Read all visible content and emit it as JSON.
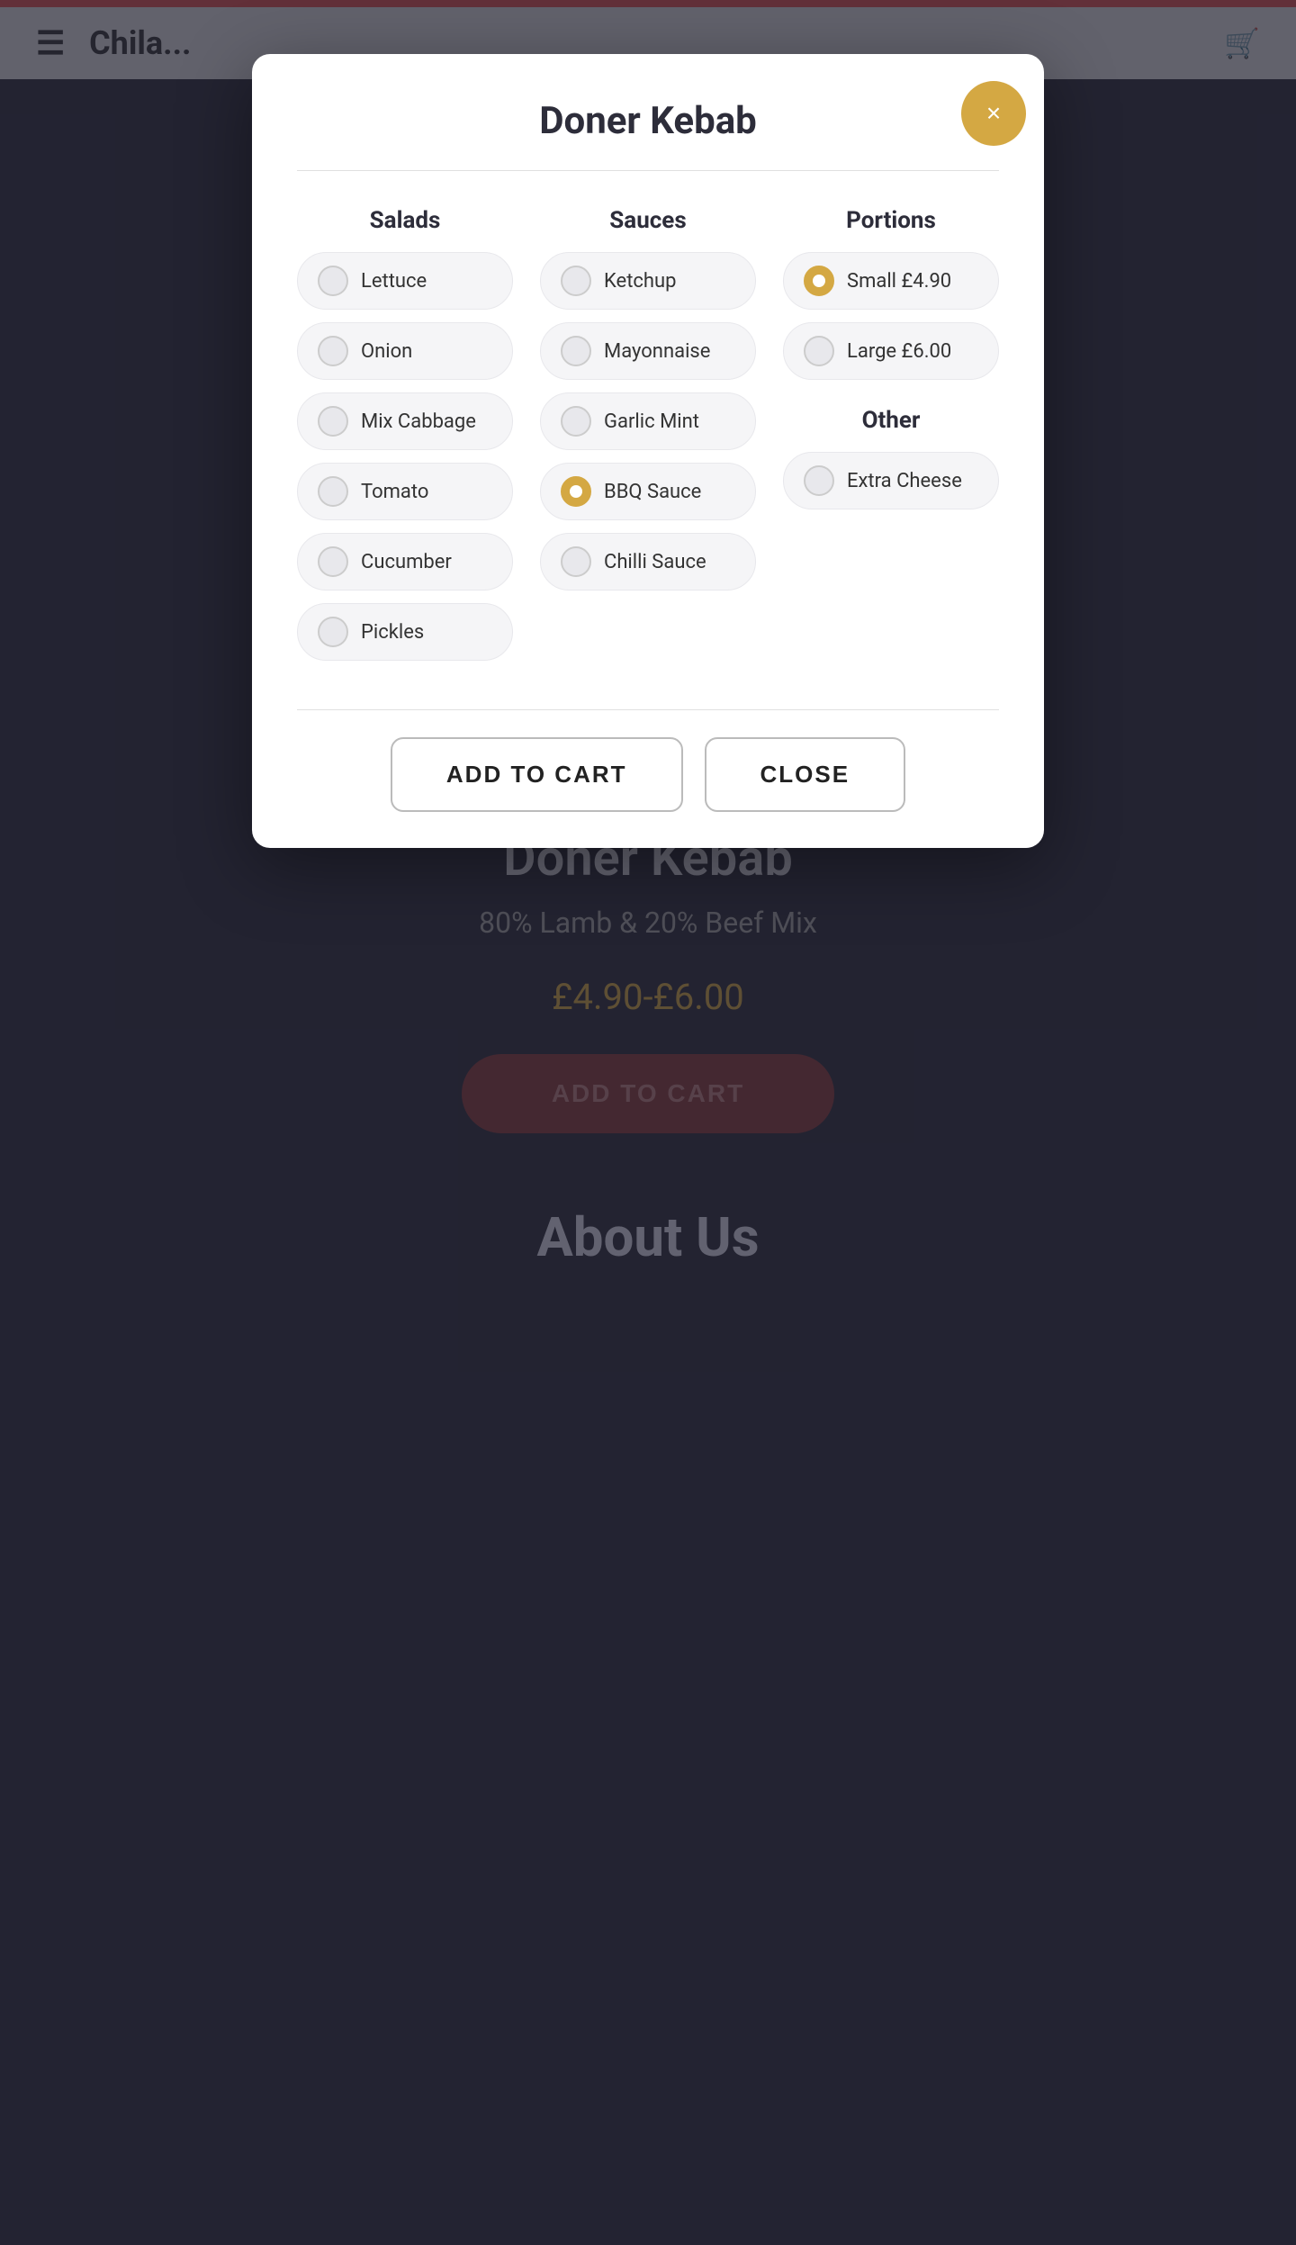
{
  "topbar": {
    "color": "#e05252"
  },
  "header": {
    "logo": "Chila...",
    "cart_icon": "🛒"
  },
  "modal": {
    "title": "Doner Kebab",
    "close_label": "×",
    "divider": true,
    "columns": {
      "salads": {
        "title": "Salads",
        "items": [
          {
            "label": "Lettuce",
            "selected": false
          },
          {
            "label": "Onion",
            "selected": false
          },
          {
            "label": "Mix Cabbage",
            "selected": false
          },
          {
            "label": "Tomato",
            "selected": false
          },
          {
            "label": "Cucumber",
            "selected": false
          },
          {
            "label": "Pickles",
            "selected": false
          }
        ]
      },
      "sauces": {
        "title": "Sauces",
        "items": [
          {
            "label": "Ketchup",
            "selected": false
          },
          {
            "label": "Mayonnaise",
            "selected": false
          },
          {
            "label": "Garlic Mint",
            "selected": false
          },
          {
            "label": "BBQ Sauce",
            "selected": true
          },
          {
            "label": "Chilli Sauce",
            "selected": false
          }
        ]
      },
      "portions": {
        "title": "Portions",
        "items": [
          {
            "label": "Small £4.90",
            "selected": true
          },
          {
            "label": "Large £6.00",
            "selected": false
          }
        ],
        "other_title": "Other",
        "other_items": [
          {
            "label": "Extra Cheese",
            "selected": false
          }
        ]
      }
    },
    "actions": {
      "add_to_cart": "ADD TO CART",
      "close": "CLOSE"
    }
  },
  "background": {
    "product_title": "Doner Kebab",
    "product_subtitle": "80% Lamb & 20% Beef Mix",
    "price": "£4.90-£6.00",
    "add_to_cart_label": "ADD TO CART",
    "about_title": "About Us"
  }
}
